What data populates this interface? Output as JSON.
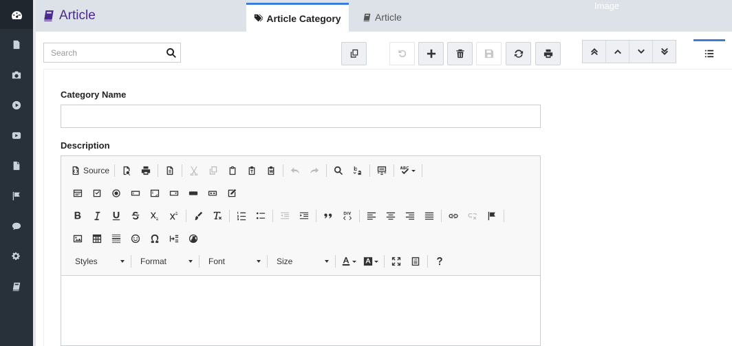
{
  "app": {
    "title": "Article"
  },
  "tabs": [
    {
      "label": "Article Category",
      "active": true
    },
    {
      "label": "Article",
      "active": false
    }
  ],
  "overlay_text": "Image",
  "search": {
    "placeholder": "Search",
    "value": ""
  },
  "form": {
    "category_name_label": "Category Name",
    "category_name_value": "",
    "description_label": "Description"
  },
  "sidebar": {
    "items": [
      "dashboard-icon",
      "document-icon",
      "camera-icon",
      "play-circle-icon",
      "youtube-icon",
      "file-icon",
      "flag-icon",
      "comment-icon",
      "settings-icon",
      "book-icon"
    ]
  },
  "toolbar": {
    "buttons": [
      "copy-icon",
      "undo-icon",
      "add-icon",
      "delete-icon",
      "save-icon",
      "refresh-icon",
      "print-icon"
    ],
    "nav": [
      "first-icon",
      "previous-icon",
      "next-icon",
      "last-icon"
    ]
  },
  "editor": {
    "source_label": "Source",
    "combos": [
      {
        "label": "Styles"
      },
      {
        "label": "Format"
      },
      {
        "label": "Font"
      },
      {
        "label": "Size"
      }
    ]
  },
  "colors": {
    "sidebar": "#283039",
    "header": "#dde1e8",
    "brand": "#4a2a8c",
    "accent": "#3c7bd8"
  }
}
